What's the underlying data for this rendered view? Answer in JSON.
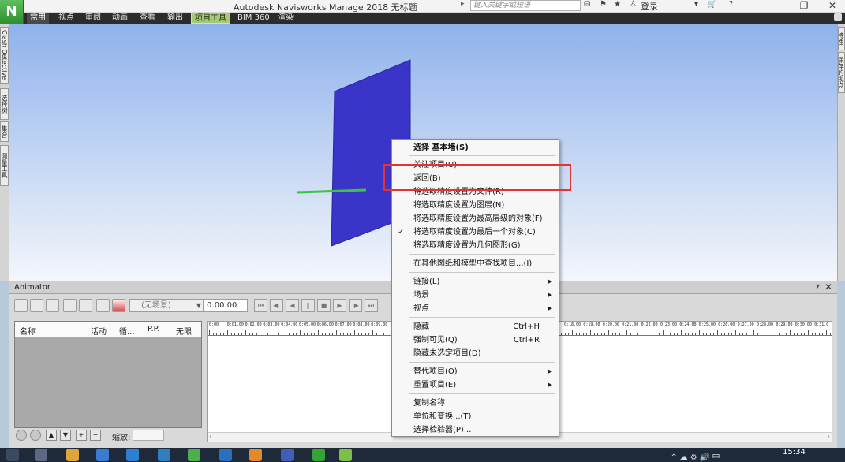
{
  "app": {
    "logo_letter": "N",
    "title": "Autodesk Navisworks Manage 2018    无标题",
    "search_placeholder": "键入关键字或短语",
    "login": "登录",
    "win_minimize": "—",
    "win_restore": "❐",
    "win_close": "✕"
  },
  "menubar": {
    "items": [
      "常用",
      "视点",
      "审阅",
      "动画",
      "查看",
      "输出",
      "项目工具",
      "BIM 360",
      "渲染"
    ]
  },
  "side_tabs": {
    "left": [
      "Clash Detective",
      "选择树",
      "集合",
      "测量工具"
    ],
    "right": [
      "特性",
      "保存的视点"
    ]
  },
  "animator": {
    "title": "Animator",
    "pin": "▾ ✕",
    "scene": "(无场景)",
    "time": "0:00.00",
    "columns": [
      "名称",
      "活动",
      "循...",
      "P.P.",
      "无限"
    ],
    "zoom_label": "缩放:",
    "ruler_labels": [
      "0:00",
      "0:01.00",
      "0:02.00",
      "0:03.00",
      "0:04.00",
      "0:05.00",
      "0:06.00",
      "0:07.00",
      "0:08.00",
      "0:09.00",
      "0:18.00",
      "0:19.00",
      "0:20.00",
      "0:21.00",
      "0:22.00",
      "0:23.00",
      "0:24.00",
      "0:25.00",
      "0:26.00",
      "0:27.00",
      "0:28.00",
      "0:29.00",
      "0:30.00",
      "0:31.0"
    ]
  },
  "context_menu": {
    "items": [
      {
        "label": "选择 基本墙(S)",
        "bold": true
      },
      {
        "label": "关注项目(U)"
      },
      {
        "label": "返回(B)"
      },
      {
        "label": "将选取精度设置为文件(R)"
      },
      {
        "label": "将选取精度设置为图层(N)"
      },
      {
        "label": "将选取精度设置为最高层级的对象(F)"
      },
      {
        "label": "将选取精度设置为最后一个对象(C)",
        "checked": true
      },
      {
        "label": "将选取精度设置为几何图形(G)"
      },
      {
        "label": "在其他图纸和模型中查找项目...(I)"
      },
      {
        "label": "链接(L)",
        "submenu": true
      },
      {
        "label": "场景",
        "submenu": true
      },
      {
        "label": "视点",
        "submenu": true
      },
      {
        "label": "隐藏",
        "shortcut": "Ctrl+H"
      },
      {
        "label": "强制可见(Q)",
        "shortcut": "Ctrl+R"
      },
      {
        "label": "隐藏未选定项目(D)"
      },
      {
        "label": "替代项目(O)",
        "submenu": true
      },
      {
        "label": "重置项目(E)",
        "submenu": true
      },
      {
        "label": "复制名称"
      },
      {
        "label": "单位和变换...(T)"
      },
      {
        "label": "选择检验器(P)..."
      }
    ],
    "check_glyph": "✓",
    "arrow_glyph": "▶"
  },
  "taskbar": {
    "time": "15:34",
    "tray": "^ ☁ ⚙ 🔊 中"
  },
  "colors": {
    "wall": "#3a35c8",
    "green_line": "#3cc43c",
    "highlight": "#e53232",
    "project_tab": "#a6c976"
  }
}
